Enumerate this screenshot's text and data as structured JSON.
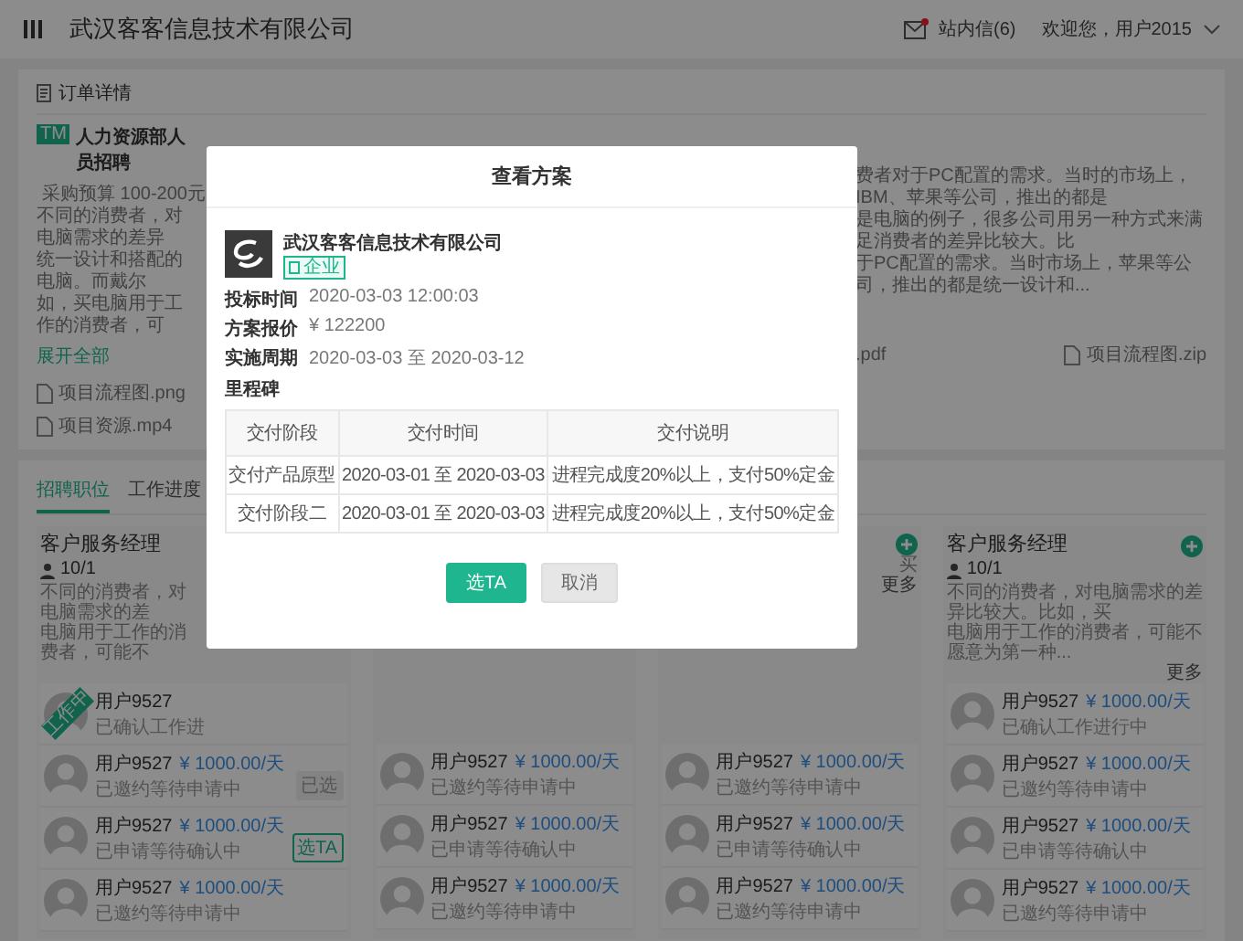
{
  "header": {
    "title": "武汉客客信息技术有限公司",
    "messages": "站内信(6)",
    "user": "欢迎您，用户2015"
  },
  "order": {
    "section_title": "订单详情",
    "tag": "TM",
    "title": "人力资源部人员招聘",
    "budget": "采购预算 100-200元",
    "description_left": [
      "不同的消费者，对电脑需求的差异",
      "统一设计和搭配的电脑。而戴尔",
      "如，买电脑用于工作的消费者，可"
    ],
    "description_right": [
      "费者对于PC配置的需求。当时的市场上，IBM、苹果等公司，推出的都是",
      "是电脑的例子，很多公司用另一种方式来满足消费者的差异比较大。比",
      "于PC配置的需求。当时市场上，苹果等公司，推出的都是统一设计和..."
    ],
    "expand": "展开全部",
    "files_left": [
      {
        "name": "项目流程图.png",
        "kind": "file"
      },
      {
        "name": "项目资源.mp4",
        "kind": "file"
      }
    ],
    "files_right": [
      {
        "name": ".pdf",
        "kind": "cut"
      },
      {
        "name": "项目流程图.zip",
        "kind": "file"
      }
    ]
  },
  "tabs": [
    {
      "label": "招聘职位",
      "selected": true
    },
    {
      "label": "工作进度",
      "selected": false
    }
  ],
  "jobs": [
    {
      "kind": "left",
      "title": "客户服务经理",
      "count": "10/1",
      "description": [
        "不同的消费者，对电脑需求的差",
        "电脑用于工作的消费者，可能不"
      ],
      "candidates": [
        {
          "name": "用户9527",
          "status": "已确认工作进",
          "ribbon": "工作中"
        },
        {
          "name": "用户9527",
          "price": "¥ 1000.00/天",
          "status": "已邀约等待申请中",
          "action": {
            "label": "已选",
            "kind": "chosen"
          }
        },
        {
          "name": "用户9527",
          "price": "¥ 1000.00/天",
          "status": "已申请等待确认中",
          "action": {
            "label": "选TA",
            "kind": "pick"
          }
        },
        {
          "name": "用户9527",
          "price": "¥ 1000.00/天",
          "status": "已邀约等待申请中"
        }
      ]
    },
    {
      "kind": "covered",
      "candidates": [
        {
          "name": "用户9527",
          "price": "¥ 1000.00/天",
          "status": "已邀约等待申请中"
        },
        {
          "name": "用户9527",
          "price": "¥ 1000.00/天",
          "status": "已申请等待确认中"
        },
        {
          "name": "用户9527",
          "price": "¥ 1000.00/天",
          "status": "已邀约等待申请中"
        }
      ]
    },
    {
      "kind": "covered",
      "plus": true,
      "description": [
        "买"
      ],
      "more": "更多",
      "candidates": [
        {
          "name": "用户9527",
          "price": "¥ 1000.00/天",
          "status": "已邀约等待申请中"
        },
        {
          "name": "用户9527",
          "price": "¥ 1000.00/天",
          "status": "已申请等待确认中"
        },
        {
          "name": "用户9527",
          "price": "¥ 1000.00/天",
          "status": "已邀约等待申请中"
        }
      ]
    },
    {
      "kind": "full",
      "title": "客户服务经理",
      "plus": true,
      "count": "10/1",
      "description": [
        "不同的消费者，对电脑需求的差异比较大。比如，买",
        "电脑用于工作的消费者，可能不愿意为第一种..."
      ],
      "more": "更多",
      "candidates": [
        {
          "name": "用户9527",
          "price": "¥ 1000.00/天",
          "status": "已确认工作进行中"
        },
        {
          "name": "用户9527",
          "price": "¥ 1000.00/天",
          "status": "已邀约等待申请中"
        },
        {
          "name": "用户9527",
          "price": "¥ 1000.00/天",
          "status": "已申请等待确认中"
        },
        {
          "name": "用户9527",
          "price": "¥ 1000.00/天",
          "status": "已邀约等待申请中"
        }
      ]
    }
  ],
  "dialog": {
    "title": "查看方案",
    "company": "武汉客客信息技术有限公司",
    "badge": "企业",
    "fields": [
      {
        "label": "投标时间",
        "value": "2020-03-03  12:00:03"
      },
      {
        "label": "方案报价",
        "value": "¥ 122200"
      },
      {
        "label": "实施周期",
        "value": "2020-03-03 至 2020-03-12"
      }
    ],
    "milestone_title": "里程碑",
    "table": {
      "columns": [
        "交付阶段",
        "交付时间",
        "交付说明"
      ],
      "rows": [
        [
          "交付产品原型",
          "2020-03-01 至 2020-03-03",
          "进程完成度20%以上，支付50%定金"
        ],
        [
          "交付阶段二",
          "2020-03-01 至 2020-03-03",
          "进程完成度20%以上，支付50%定金"
        ]
      ]
    },
    "buttons": [
      {
        "label": "选TA",
        "kind": "primary"
      },
      {
        "label": "取消",
        "kind": "secondary"
      }
    ]
  }
}
